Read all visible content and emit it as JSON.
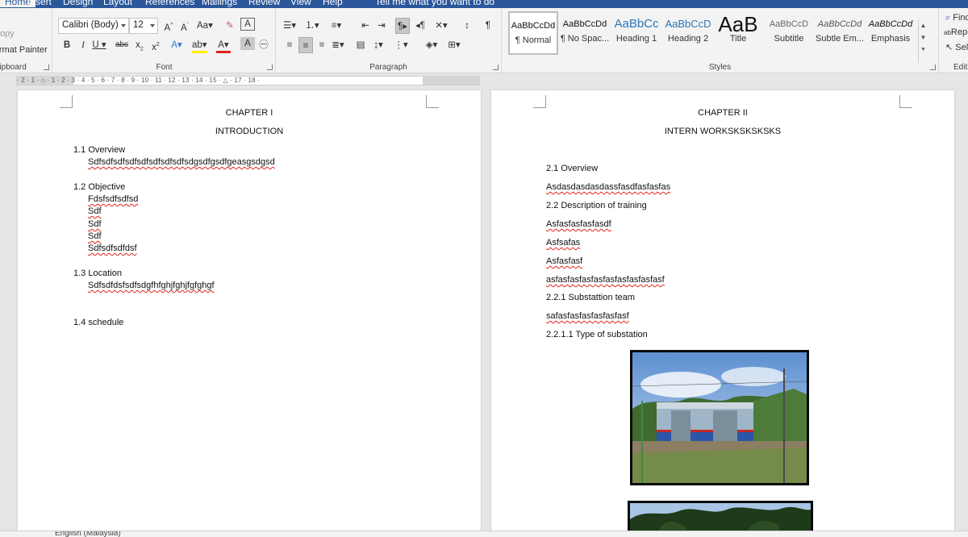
{
  "tabs": [
    "Home",
    "Insert",
    "Design",
    "Layout",
    "References",
    "Mailings",
    "Review",
    "View",
    "Help",
    "Tell me what you want to do"
  ],
  "clipboard": {
    "items": [
      "Copy",
      "Format Painter"
    ],
    "label": "Clipboard"
  },
  "font": {
    "name": "Calibri (Body)",
    "size": "12",
    "label": "Font"
  },
  "paragraph": {
    "label": "Paragraph"
  },
  "styles": {
    "label": "Styles",
    "items": [
      {
        "sample": "AaBbCcDd",
        "name": "¶ Normal"
      },
      {
        "sample": "AaBbCcDd",
        "name": "¶ No Spac..."
      },
      {
        "sample": "AaBbCc",
        "name": "Heading 1"
      },
      {
        "sample": "AaBbCcD",
        "name": "Heading 2"
      },
      {
        "sample": "AaB",
        "name": "Title"
      },
      {
        "sample": "AaBbCcD",
        "name": "Subtitle"
      },
      {
        "sample": "AaBbCcDd",
        "name": "Subtle Em..."
      },
      {
        "sample": "AaBbCcDd",
        "name": "Emphasis"
      }
    ]
  },
  "editing": {
    "items": [
      "Find",
      "Replace",
      "Select"
    ],
    "label": "Editing"
  },
  "ruler": {
    "marks": "· 2 · 1 · ⌂ · 1 · 2 · 3 · 4 · 5 · 6 · 7 · 8 · 9 · 10 · 11 · 12 · 13 · 14 · 15 · △ · 17 · 18 ·"
  },
  "page1": {
    "chapter": "CHAPTER I",
    "title": "INTRODUCTION",
    "s1": "1.1 Overview",
    "s1_text": "Sdfsdfsdfsdfsdfsdfsdfsdfsdgsdfgsdfgeasgsdgsd",
    "s2": "1.2 Objective",
    "s2_items": [
      "Fdsfsdfsdfsd",
      "Sdf",
      "Sdf",
      "Sdf",
      "Sdfsdfsdfdsf"
    ],
    "s3": "1.3 Location",
    "s3_text": "Sdfsdfdsfsdfsdgfhfghjfghjfgfghgf",
    "s4": "1.4 schedule"
  },
  "page2": {
    "chapter": "CHAPTER II",
    "title": "INTERN WORKSKSKSKSKS",
    "lines": [
      {
        "text": "2.1 Overview",
        "sq": false
      },
      {
        "text": "Asdasdasdasdassfasdfasfasfas",
        "sq": true
      },
      {
        "text": "2.2 Description of training",
        "sq": false
      },
      {
        "text": "Asfasfasfasfasdf",
        "sq": true
      },
      {
        "text": "Asfsafas",
        "sq": true
      },
      {
        "text": "Asfasfasf",
        "sq": true
      },
      {
        "text": "asfasfasfasfasfasfasfasfasfasf",
        "sq": true
      },
      {
        "text": "2.2.1 Substattion team",
        "sq": false
      },
      {
        "text": "safasfasfasfasfasfasf",
        "sq": true
      },
      {
        "text": "2.2.1.1 Type of substation",
        "sq": false
      }
    ]
  },
  "status": {
    "language": "English (Malaysia)"
  }
}
